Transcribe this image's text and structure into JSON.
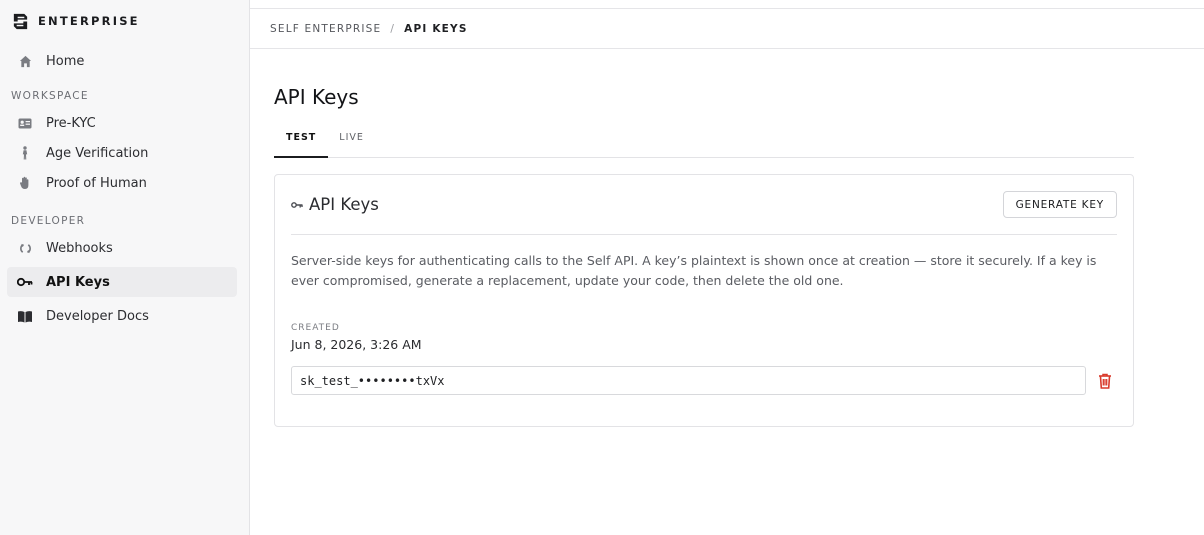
{
  "brand": {
    "name": "ENTERPRISE"
  },
  "sidebar": {
    "home": "Home",
    "workspace_label": "WORKSPACE",
    "workspace_items": [
      "Pre-KYC",
      "Age Verification",
      "Proof of Human"
    ],
    "developer_label": "DEVELOPER",
    "developer_items": [
      "Webhooks",
      "API Keys",
      "Developer Docs"
    ],
    "active_item": "API Keys"
  },
  "breadcrumb": {
    "root": "SELF ENTERPRISE",
    "separator": "/",
    "current": "API KEYS"
  },
  "page": {
    "title": "API Keys"
  },
  "tabs": [
    {
      "label": "TEST",
      "active": true
    },
    {
      "label": "LIVE",
      "active": false
    }
  ],
  "card": {
    "title": "API Keys",
    "generate_button": "GENERATE KEY",
    "description": "Server-side keys for authenticating calls to the Self API. A key’s plaintext is shown once at creation — store it securely. If a key is ever compromised, generate a replacement, update your code, then delete the old one.",
    "created_label": "CREATED",
    "created_value": "Jun 8, 2026, 3:26 AM",
    "key_value": "sk_test_••••••••txVx"
  },
  "colors": {
    "accent": "#1b1c1f",
    "danger": "#d93a2b",
    "sidebar_bg": "#f7f7f8"
  },
  "icons": {
    "brand": "enterprise-logo-icon",
    "home": "home-icon",
    "pre_kyc": "id-card-icon",
    "age_verification": "person-icon",
    "proof_of_human": "hand-icon",
    "webhooks": "webhook-icon",
    "api_keys": "key-icon",
    "developer_docs": "book-icon",
    "delete": "trash-icon"
  }
}
